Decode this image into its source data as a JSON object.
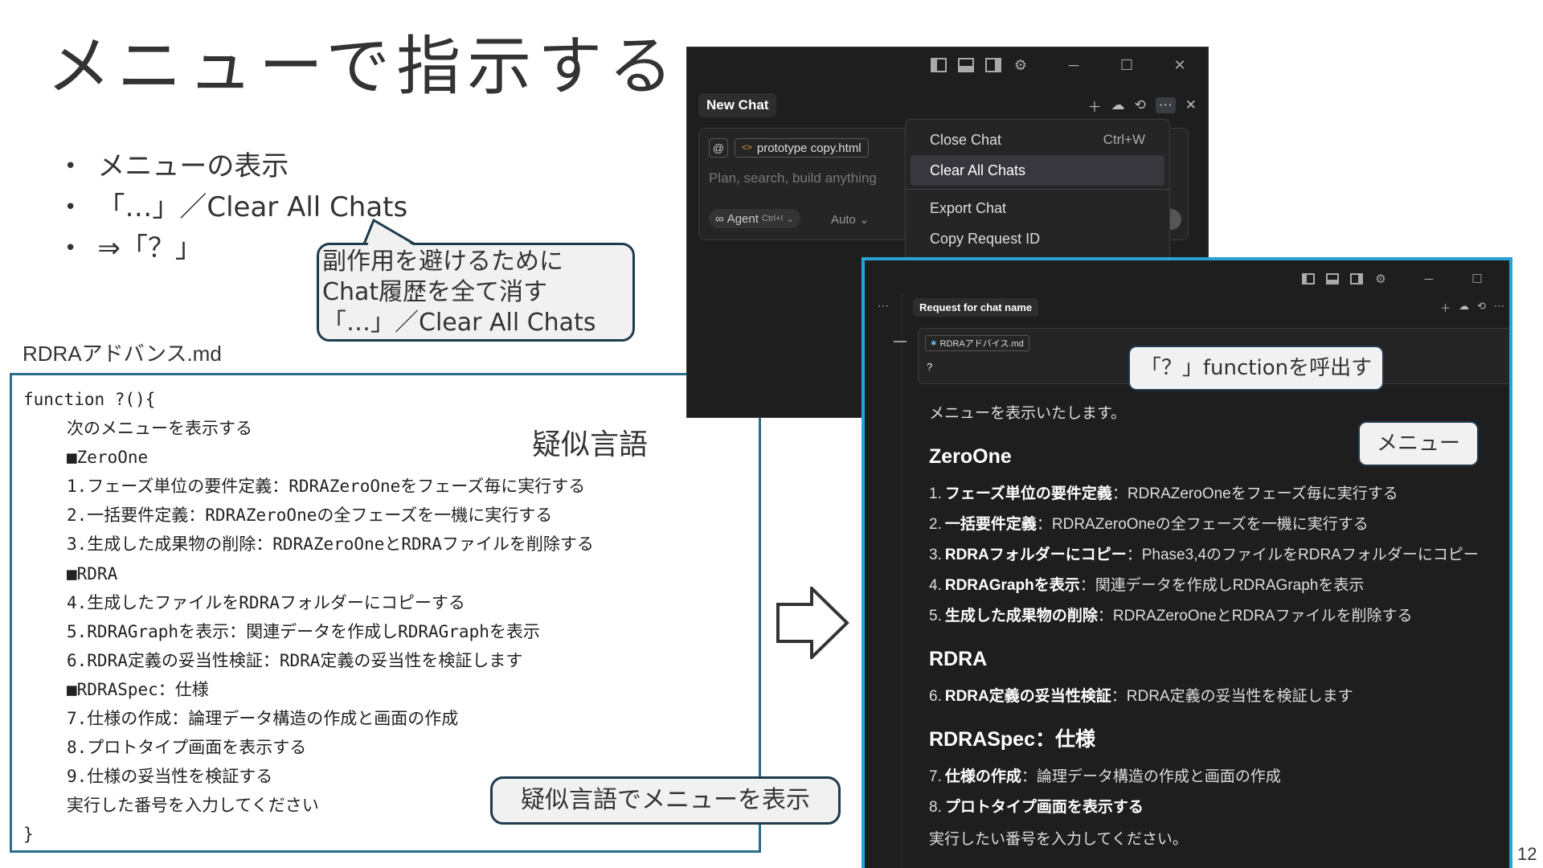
{
  "slide": {
    "title": "メニューで指示する",
    "bullets": [
      "メニューの表示",
      "「…」／Clear All Chats",
      "⇒「？」"
    ],
    "page_number": "12"
  },
  "callouts": {
    "side_effect": [
      "副作用を避けるために",
      "Chat履歴を全て消す",
      "「…」／Clear All Chats"
    ],
    "call_function": "「？」functionを呼出す",
    "menu": "メニュー",
    "pseudo_menu": "疑似言語でメニューを表示"
  },
  "code_panel": {
    "file_label": "RDRAアドバンス.md",
    "pseudo_label": "疑似言語",
    "lines": [
      {
        "text": "function ?(){",
        "indent": false
      },
      {
        "text": "次のメニューを表示する",
        "indent": true
      },
      {
        "text": "■ZeroOne",
        "indent": true
      },
      {
        "text": "1.フェーズ単位の要件定義：RDRAZeroOneをフェーズ毎に実行する",
        "indent": true
      },
      {
        "text": "2.一括要件定義：RDRAZeroOneの全フェーズを一機に実行する",
        "indent": true
      },
      {
        "text": "3.生成した成果物の削除：RDRAZeroOneとRDRAファイルを削除する",
        "indent": true
      },
      {
        "text": "■RDRA",
        "indent": true
      },
      {
        "text": "4.生成したファイルをRDRAフォルダーにコピーする",
        "indent": true
      },
      {
        "text": "5.RDRAGraphを表示：関連データを作成しRDRAGraphを表示",
        "indent": true
      },
      {
        "text": "6.RDRA定義の妥当性検証：RDRA定義の妥当性を検証します",
        "indent": true
      },
      {
        "text": "■RDRASpec：仕様",
        "indent": true
      },
      {
        "text": "7.仕様の作成：論理データ構造の作成と画面の作成",
        "indent": true
      },
      {
        "text": "8.プロトタイプ画面を表示する",
        "indent": true
      },
      {
        "text": "9.仕様の妥当性を検証する",
        "indent": true
      },
      {
        "text": "実行した番号を入力してください",
        "indent": true
      },
      {
        "text": "}",
        "indent": false
      }
    ]
  },
  "window1": {
    "chat_tab": "New Chat",
    "file_chip": "prototype copy.html",
    "file_tag": "<>",
    "at_symbol": "@",
    "placeholder": "Plan, search, build anything",
    "agent_label": "Agent",
    "agent_shortcut": "Ctrl+I",
    "auto_label": "Auto",
    "menu": [
      {
        "label": "Close Chat",
        "shortcut": "Ctrl+W"
      },
      {
        "label": "Clear All Chats",
        "shortcut": ""
      },
      {
        "label": "Export Chat",
        "shortcut": ""
      },
      {
        "label": "Copy Request ID",
        "shortcut": ""
      }
    ]
  },
  "window2": {
    "chat_tab": "Request for chat name",
    "file_chip": "RDRAアドバイス.md",
    "query": "?",
    "intro": "メニューを表示いたします。",
    "sections": [
      {
        "heading": "ZeroOne",
        "items": [
          {
            "num": "1.",
            "bold": "フェーズ単位の要件定義",
            "rest": "：RDRAZeroOneをフェーズ毎に実行する"
          },
          {
            "num": "2.",
            "bold": "一括要件定義",
            "rest": "：RDRAZeroOneの全フェーズを一機に実行する"
          },
          {
            "num": "3.",
            "bold": "RDRAフォルダーにコピー",
            "rest": "：Phase3,4のファイルをRDRAフォルダーにコピー"
          },
          {
            "num": "4.",
            "bold": "RDRAGraphを表示",
            "rest": "：関連データを作成しRDRAGraphを表示"
          },
          {
            "num": "5.",
            "bold": "生成した成果物の削除",
            "rest": "：RDRAZeroOneとRDRAファイルを削除する"
          }
        ]
      },
      {
        "heading": "RDRA",
        "items": [
          {
            "num": "6.",
            "bold": "RDRA定義の妥当性検証",
            "rest": "：RDRA定義の妥当性を検証します"
          }
        ]
      },
      {
        "heading": "RDRASpec：仕様",
        "items": [
          {
            "num": "7.",
            "bold": "仕様の作成",
            "rest": "：論理データ構造の作成と画面の作成"
          },
          {
            "num": "8.",
            "bold": "プロトタイプ画面を表示する",
            "rest": ""
          }
        ]
      }
    ],
    "outro": "実行したい番号を入力してください。"
  },
  "icons": [
    "layout-left-icon",
    "layout-bottom-icon",
    "layout-right-icon",
    "gear-icon",
    "minimize-icon",
    "maximize-icon",
    "close-icon",
    "plus-icon",
    "cloud-icon",
    "history-icon",
    "more-icon",
    "right-arrow-icon"
  ],
  "colors": {
    "accent_blue": "#2aa0d4",
    "callout_border": "#1f3b4d",
    "dark_bg": "#1e1e1e"
  }
}
